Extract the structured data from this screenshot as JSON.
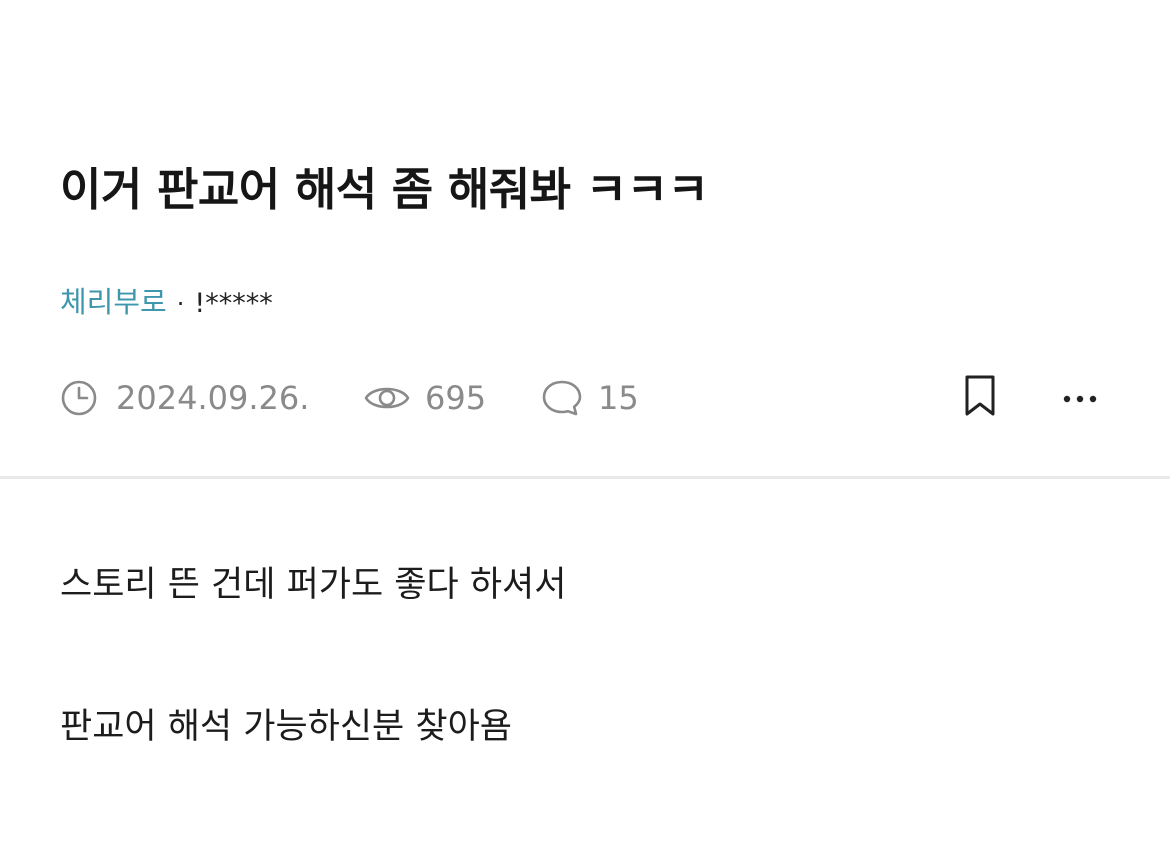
{
  "post": {
    "title": "이거 판교어 해석 좀 해줘봐 ㅋㅋㅋ",
    "author": {
      "name": "체리부로",
      "separator": "·",
      "id": "!*****"
    },
    "meta": {
      "date": "2024.09.26.",
      "views": "695",
      "comments": "15"
    },
    "body": [
      "스토리 뜬 건데 퍼가도 좋다 하셔서",
      "판교어 해석 가능하신분 찾아욤"
    ]
  },
  "icons": {
    "date": "clock-icon",
    "views": "eye-icon",
    "comments": "speech-bubble-icon",
    "bookmark": "bookmark-icon",
    "more": "more-dots-icon"
  },
  "colors": {
    "author_name": "#3f97ad",
    "meta_text": "#8a8a8a",
    "divider": "#e9e9e9"
  }
}
